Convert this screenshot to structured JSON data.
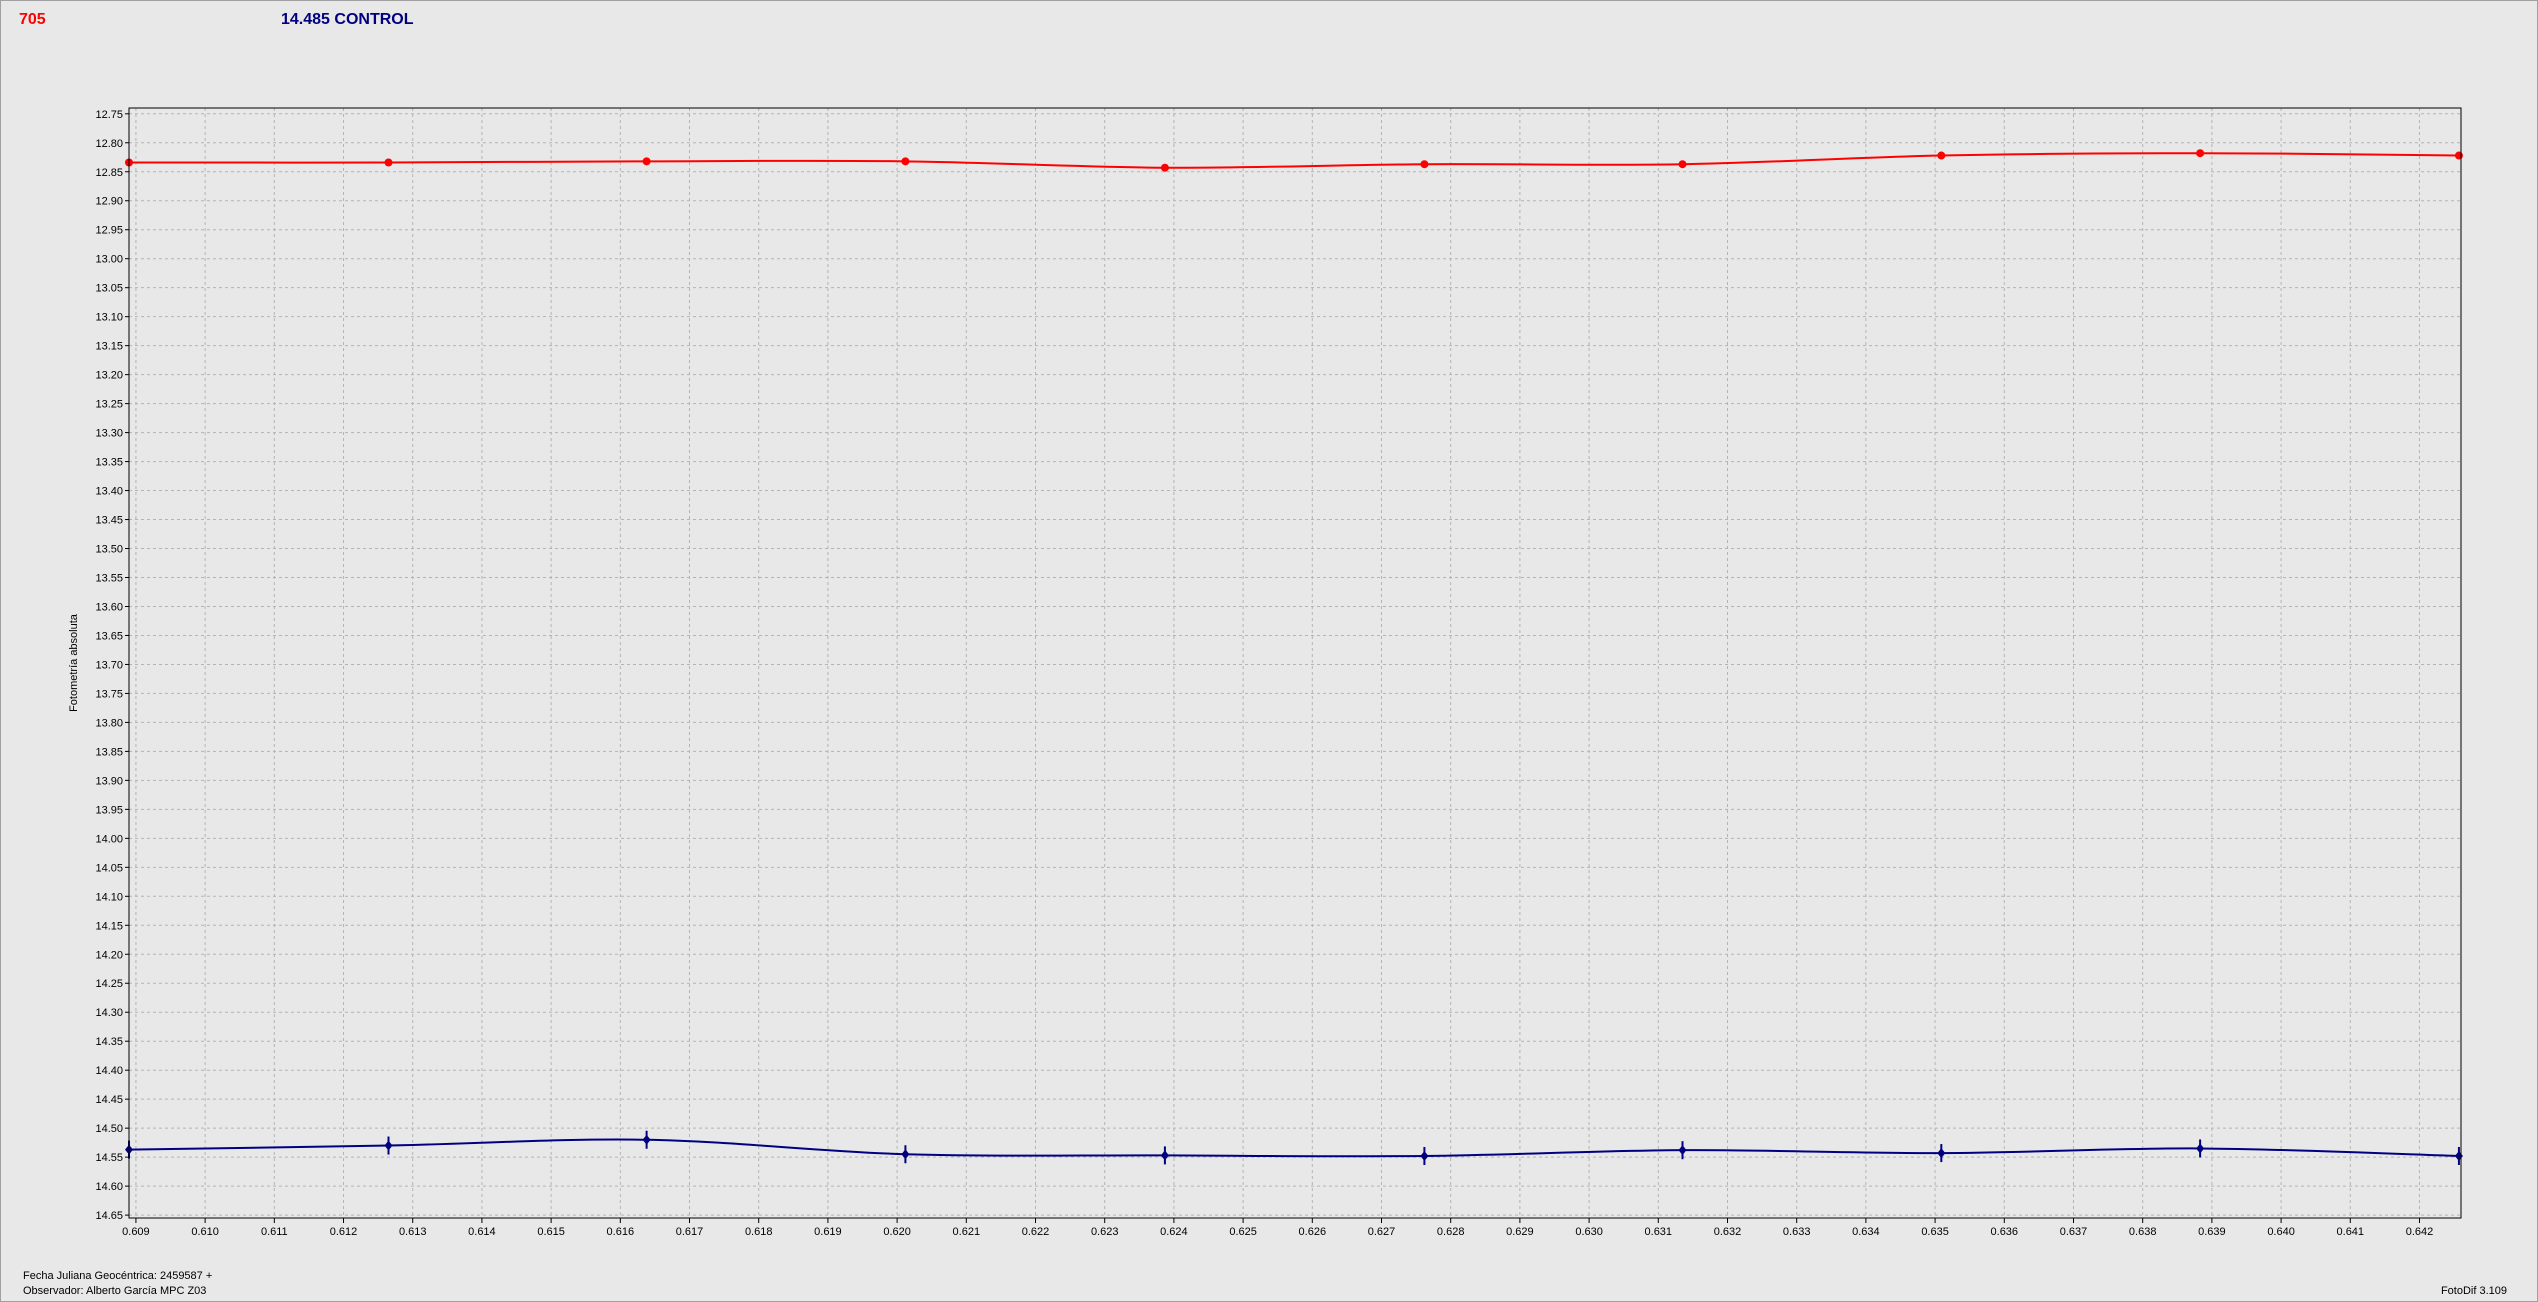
{
  "header": {
    "object_label": "705",
    "control_label": "14.485 CONTROL"
  },
  "footer": {
    "line1": "Fecha Juliana Geocéntrica: 2459587 +",
    "line2": "Observador: Alberto García MPC Z03",
    "version": "FotoDif 3.109"
  },
  "colors": {
    "series_object": "#ff0000",
    "series_control": "#000080",
    "grid": "#b4b4b4",
    "axis": "#000000"
  },
  "chart_data": {
    "type": "line",
    "ylabel": "Fotometría absoluta",
    "xlabel": "",
    "xlim": [
      0.6089,
      0.6426
    ],
    "ylim": [
      12.74,
      14.655
    ],
    "y_inverted": true,
    "grid": true,
    "x_ticks": [
      "0.609",
      "0.610",
      "0.611",
      "0.612",
      "0.613",
      "0.614",
      "0.615",
      "0.616",
      "0.617",
      "0.618",
      "0.619",
      "0.620",
      "0.621",
      "0.622",
      "0.623",
      "0.624",
      "0.625",
      "0.626",
      "0.627",
      "0.628",
      "0.629",
      "0.630",
      "0.631",
      "0.632",
      "0.633",
      "0.634",
      "0.635",
      "0.636",
      "0.637",
      "0.638",
      "0.639",
      "0.640",
      "0.641",
      "0.642"
    ],
    "y_ticks": [
      "12.75",
      "12.80",
      "12.85",
      "12.90",
      "12.95",
      "13.00",
      "13.05",
      "13.10",
      "13.15",
      "13.20",
      "13.25",
      "13.30",
      "13.35",
      "13.40",
      "13.45",
      "13.50",
      "13.55",
      "13.60",
      "13.65",
      "13.70",
      "13.75",
      "13.80",
      "13.85",
      "13.90",
      "13.95",
      "14.00",
      "14.05",
      "14.10",
      "14.15",
      "14.20",
      "14.25",
      "14.30",
      "14.35",
      "14.40",
      "14.45",
      "14.50",
      "14.55",
      "14.60",
      "14.65"
    ],
    "x": [
      0.6089,
      0.61265,
      0.61638,
      0.62012,
      0.62387,
      0.62762,
      0.63135,
      0.63509,
      0.63883,
      0.64257
    ],
    "series": [
      {
        "values": [
          12.834,
          12.834,
          12.832,
          12.832,
          12.843,
          12.837,
          12.837,
          12.822,
          12.818,
          12.822
        ],
        "marker": "circle"
      },
      {
        "values": [
          14.537,
          14.53,
          14.52,
          14.545,
          14.547,
          14.548,
          14.538,
          14.543,
          14.535,
          14.548
        ],
        "marker": "diamond-errorbar"
      }
    ]
  }
}
